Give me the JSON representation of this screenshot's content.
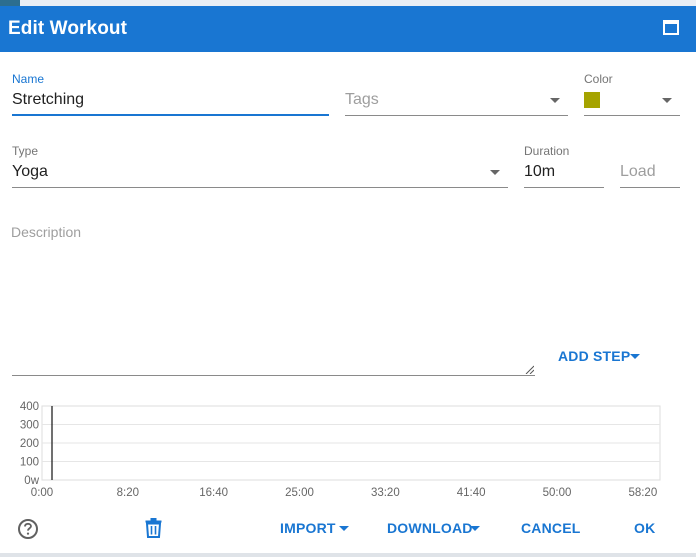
{
  "dialog": {
    "title": "Edit Workout",
    "maximize_icon": "maximize-icon"
  },
  "form": {
    "name": {
      "label": "Name",
      "value": "Stretching"
    },
    "tags": {
      "placeholder": "Tags"
    },
    "color": {
      "label": "Color",
      "value": "#a5a300"
    },
    "type": {
      "label": "Type",
      "value": "Yoga"
    },
    "duration": {
      "label": "Duration",
      "value": "10m"
    },
    "load": {
      "placeholder": "Load"
    },
    "description": {
      "placeholder": "Description"
    }
  },
  "actions": {
    "add_step": "ADD STEP",
    "import": "IMPORT",
    "download": "DOWNLOAD",
    "cancel": "CANCEL",
    "ok": "OK",
    "help_icon": "help-circle-icon",
    "delete_icon": "trash-icon"
  },
  "chart_data": {
    "type": "line",
    "y_ticks": [
      "400",
      "300",
      "200",
      "100",
      "0w"
    ],
    "x_ticks": [
      "0:00",
      "8:20",
      "16:40",
      "25:00",
      "33:20",
      "41:40",
      "50:00",
      "58:20"
    ],
    "ylim": [
      0,
      400
    ],
    "xlim_seconds": [
      0,
      3600
    ],
    "series": [
      {
        "x": [
          0,
          0
        ],
        "y": [
          0,
          400
        ]
      }
    ],
    "grid": true
  },
  "colors": {
    "accent": "#1976d2",
    "swatch": "#a5a300"
  }
}
